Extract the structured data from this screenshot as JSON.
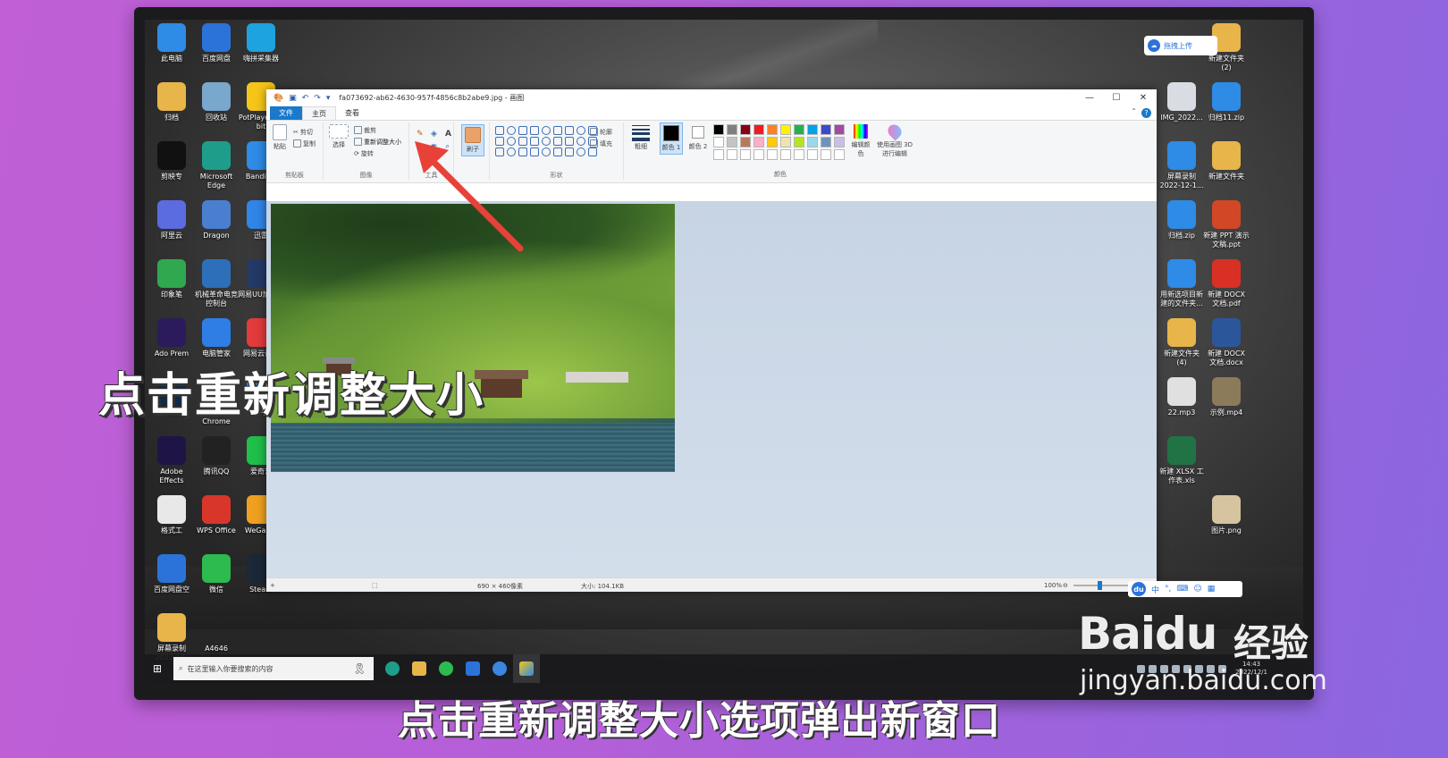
{
  "desktop_left": [
    {
      "label": "此电脑",
      "icon": "computer-icon",
      "color": "#2e8be6"
    },
    {
      "label": "百度网盘",
      "icon": "baidu-netdisk-icon",
      "color": "#2b73d8"
    },
    {
      "label": "嗨拼采集器",
      "icon": "collector-icon",
      "color": "#1ca3e0"
    },
    {
      "label": "归档",
      "icon": "folder-icon",
      "color": "#e8b54a"
    },
    {
      "label": "回收站",
      "icon": "recycle-bin-icon",
      "color": "#7aa7cc"
    },
    {
      "label": "PotPlayer 64 bit",
      "icon": "potplayer-icon",
      "color": "#f5c518"
    },
    {
      "label": "剪映专",
      "icon": "capcut-icon",
      "color": "#111111"
    },
    {
      "label": "Microsoft Edge",
      "icon": "edge-icon",
      "color": "#1e9e8a"
    },
    {
      "label": "Bandizip",
      "icon": "bandizip-icon",
      "color": "#2e8be6"
    },
    {
      "label": "阿里云",
      "icon": "aliyun-icon",
      "color": "#5b6be0"
    },
    {
      "label": "Dragon",
      "icon": "dragon-icon",
      "color": "#4a7fd0"
    },
    {
      "label": "迅雷",
      "icon": "xunlei-icon",
      "color": "#2f86e8"
    },
    {
      "label": "印象笔",
      "icon": "evernote-icon",
      "color": "#2fa84f"
    },
    {
      "label": "机械革命电竞控制台",
      "icon": "mechrevo-icon",
      "color": "#2d6fb8"
    },
    {
      "label": "网易UU加速器",
      "icon": "uu-icon",
      "color": "#233a66"
    },
    {
      "label": "Ado Prem",
      "icon": "premiere-icon",
      "color": "#2b1b5c"
    },
    {
      "label": "电脑管家",
      "icon": "pc-manager-icon",
      "color": "#2e7ee6"
    },
    {
      "label": "网易云音乐",
      "icon": "netease-music-icon",
      "color": "#e23b3b"
    },
    {
      "label": "Ado",
      "icon": "photoshop-icon",
      "color": "#0f2a4a"
    },
    {
      "label": "Google Chrome",
      "icon": "chrome-icon",
      "color": "#e8e8e8"
    },
    {
      "label": "飞书",
      "icon": "feishu-icon",
      "color": "#3370ff"
    },
    {
      "label": "Adobe Effects",
      "icon": "after-effects-icon",
      "color": "#1f1446"
    },
    {
      "label": "腾讯QQ",
      "icon": "qq-icon",
      "color": "#222222"
    },
    {
      "label": "爱奇艺",
      "icon": "iqiyi-icon",
      "color": "#1fbf4a"
    },
    {
      "label": "格式工",
      "icon": "format-icon",
      "color": "#e8e8e8"
    },
    {
      "label": "WPS Office",
      "icon": "wps-icon",
      "color": "#d9362b"
    },
    {
      "label": "WeGame",
      "icon": "wegame-icon",
      "color": "#f0a020"
    },
    {
      "label": "百度网盘空",
      "icon": "netdisk-space-icon",
      "color": "#2b73d8"
    },
    {
      "label": "微信",
      "icon": "wechat-icon",
      "color": "#2dbb4f"
    },
    {
      "label": "Steam",
      "icon": "steam-icon",
      "color": "#1b2838"
    },
    {
      "label": "屏幕录制 2022-12-",
      "icon": "folder-icon",
      "color": "#e8b54a"
    },
    {
      "label": "A4646",
      "icon": "file-icon",
      "color": "#00000000"
    }
  ],
  "desktop_right": [
    {
      "label": "新建文件夹 (2)",
      "icon": "folder-icon",
      "color": "#e8b54a"
    },
    {
      "label": "IMG_2022...",
      "icon": "image-file-icon",
      "color": "#d9dde3"
    },
    {
      "label": "归档11.zip",
      "icon": "zip-icon",
      "color": "#2e8be6"
    },
    {
      "label": "屏幕录制 2022-12-1...",
      "icon": "zip-icon",
      "color": "#2e8be6"
    },
    {
      "label": "新建文件夹",
      "icon": "folder-icon",
      "color": "#e8b54a"
    },
    {
      "label": "归档.zip",
      "icon": "zip-icon",
      "color": "#2e8be6"
    },
    {
      "label": "新建 PPT 演示文稿.ppt",
      "icon": "ppt-icon",
      "color": "#d24726"
    },
    {
      "label": "用新选项目新建的文件夹...",
      "icon": "zip-icon",
      "color": "#2e8be6"
    },
    {
      "label": "新建 DOCX 文档.pdf",
      "icon": "pdf-icon",
      "color": "#d93025"
    },
    {
      "label": "新建文件夹 (4)",
      "icon": "folder-icon",
      "color": "#e8b54a"
    },
    {
      "label": "新建 DOCX 文档.docx",
      "icon": "docx-icon",
      "color": "#2b579a"
    },
    {
      "label": "22.mp3",
      "icon": "mp3-icon",
      "color": "#e0e0e0"
    },
    {
      "label": "示例.mp4",
      "icon": "mp4-icon",
      "color": "#8c7b5a"
    },
    {
      "label": "新建 XLSX 工作表.xls",
      "icon": "xlsx-icon",
      "color": "#217346"
    },
    {
      "label": "图片.png",
      "icon": "png-icon",
      "color": "#d6c3a0"
    }
  ],
  "upload_panel": {
    "label": "拖拽上传"
  },
  "paint": {
    "title": "fa073692-ab62-4630-957f-4856c8b2abe9.jpg - 画图",
    "tabs": [
      "文件",
      "主页",
      "查看"
    ],
    "clipboard": {
      "paste": "粘贴",
      "cut": "剪切",
      "copy": "复制",
      "group": "剪贴板"
    },
    "image": {
      "select": "选择",
      "crop": "裁剪",
      "resize": "重新调整大小",
      "rotate": "旋转",
      "group": "图像"
    },
    "tools_group": "工具",
    "brushes": "刷子",
    "shapes": {
      "outline": "轮廓",
      "fill": "填充",
      "group": "形状"
    },
    "size": "粗细",
    "color1": "颜色 1",
    "color2": "颜色 2",
    "edit_colors": "编辑颜色",
    "paint3d": "使用画图 3D 进行编辑",
    "colors_group": "颜色",
    "palette": [
      "#000000",
      "#7f7f7f",
      "#880015",
      "#ed1c24",
      "#ff7f27",
      "#fff200",
      "#22b14c",
      "#00a2e8",
      "#3f48cc",
      "#a349a4",
      "#ffffff",
      "#c3c3c3",
      "#b97a57",
      "#ffaec9",
      "#ffc90e",
      "#efe4b0",
      "#b5e61d",
      "#99d9ea",
      "#7092be",
      "#c8bfe7",
      "#ffffff",
      "#ffffff",
      "#ffffff",
      "#ffffff",
      "#ffffff",
      "#ffffff",
      "#ffffff",
      "#ffffff",
      "#ffffff",
      "#ffffff"
    ],
    "status": {
      "dimensions": "690 × 460像素",
      "filesize": "大小: 104.1KB",
      "zoom": "100%"
    }
  },
  "ime": {
    "du": "du",
    "mode": "中"
  },
  "taskbar": {
    "search_placeholder": "在这里输入你要搜索的内容",
    "clock_time": "14:43",
    "clock_date": "2022/12/1"
  },
  "captions": {
    "overlay": "点击重新调整大小",
    "bottom": "点击重新调整大小选项弹出新窗口"
  },
  "watermark": {
    "brand": "Baidu",
    "product": "经验",
    "url": "jingyan.baidu.com"
  }
}
